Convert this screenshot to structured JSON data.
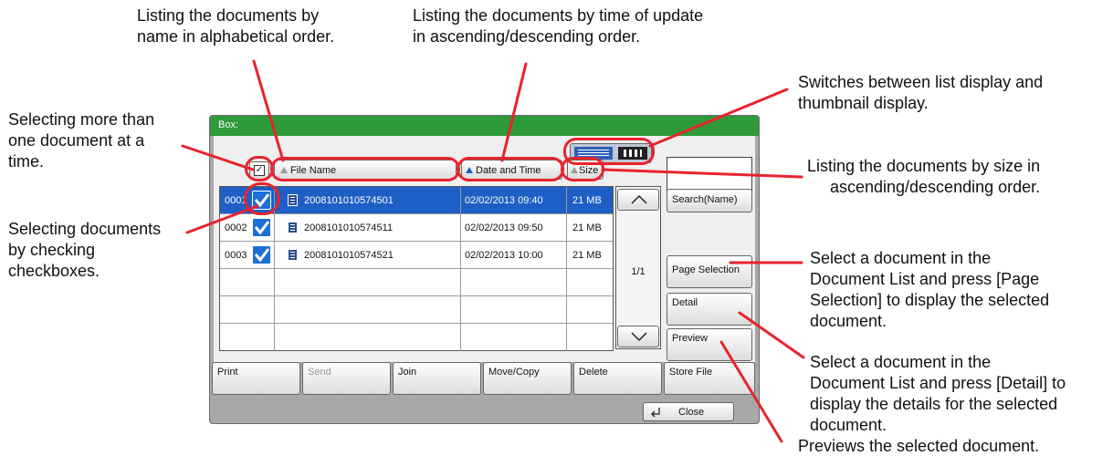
{
  "annotations": {
    "by_name": "Listing the documents by\nname in alphabetical order.",
    "by_time": "Listing the documents by time of update\nin ascending/descending order.",
    "switch_display": "Switches between list display and\nthumbnail display.",
    "select_multiple": "Selecting more than\none document at a\ntime.",
    "by_size": "Listing the documents by size in\nascending/descending order.",
    "checkboxes": "Selecting documents\nby checking\ncheckboxes.",
    "page_selection": "Select a document in the\nDocument List and press [Page\nSelection] to display the selected\ndocument.",
    "detail": "Select a document in the\nDocument List and press [Detail] to\ndisplay the details for the selected\ndocument.",
    "preview": "Previews the selected document."
  },
  "panel": {
    "title": "Box:",
    "columns": {
      "file_name": "File Name",
      "date_time": "Date and Time",
      "size": "Size"
    },
    "rows": [
      {
        "num": "0001",
        "name": "2008101010574501",
        "date": "02/02/2013 09:40",
        "size": "21 MB",
        "selected": true
      },
      {
        "num": "0002",
        "name": "2008101010574511",
        "date": "02/02/2013 09:50",
        "size": "21 MB",
        "selected": false
      },
      {
        "num": "0003",
        "name": "2008101010574521",
        "date": "02/02/2013 10:00",
        "size": "21 MB",
        "selected": false
      }
    ],
    "page_indicator": "1/1",
    "side_buttons": {
      "search": "Search(Name)",
      "page_selection": "Page Selection",
      "detail": "Detail",
      "preview": "Preview"
    },
    "bottom_buttons": {
      "print": "Print",
      "send": "Send",
      "join": "Join",
      "move_copy": "Move/Copy",
      "delete": "Delete",
      "store_file": "Store File"
    },
    "close": "Close"
  },
  "colors": {
    "accent_red": "#e8232d",
    "header_green": "#2e9a3b",
    "selection_blue": "#1d5fc4"
  }
}
